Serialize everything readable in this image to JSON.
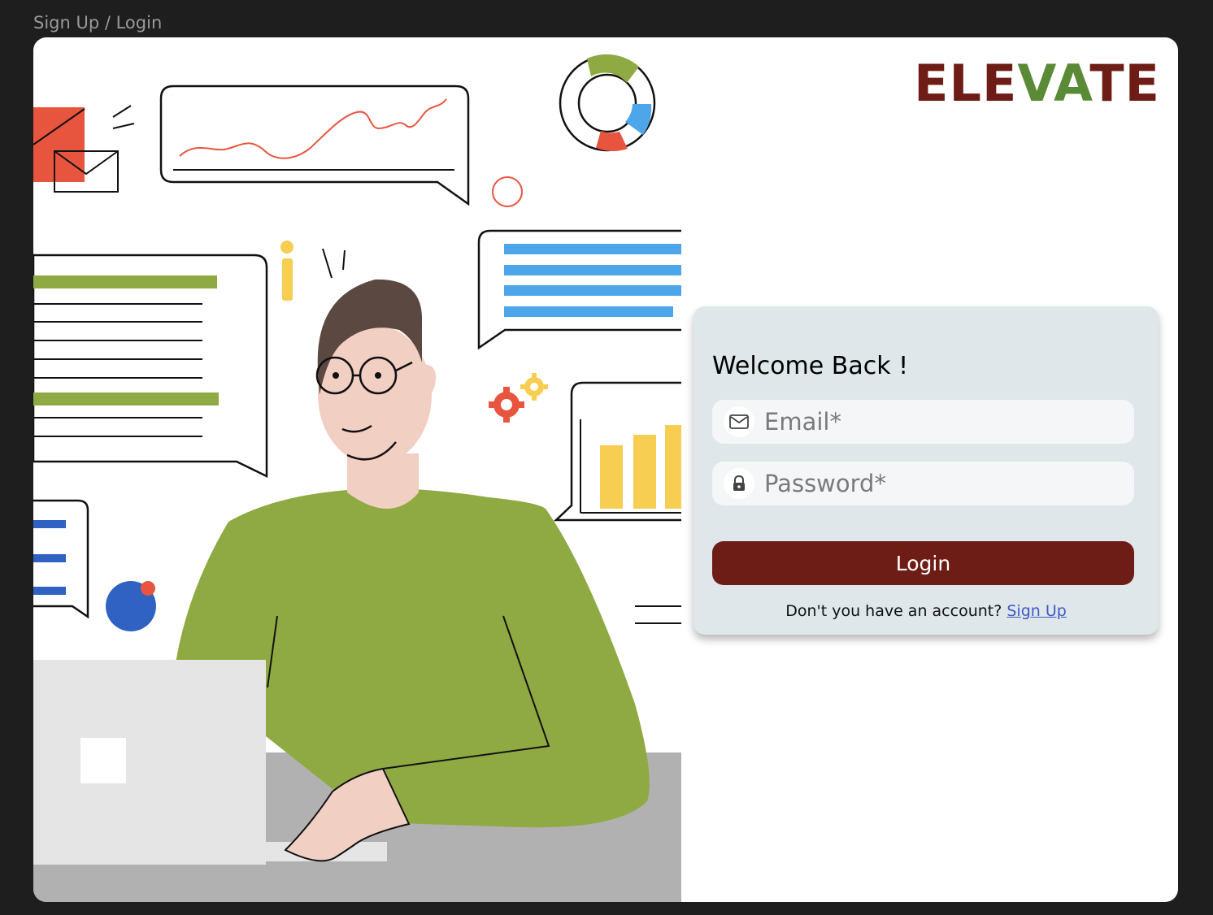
{
  "window": {
    "title": "Sign Up / Login"
  },
  "brand": {
    "parts": [
      {
        "text": "ELE",
        "color": "#6e1c16"
      },
      {
        "text": "VA",
        "color": "#5a8a35"
      },
      {
        "text": "TE",
        "color": "#6e1c16"
      }
    ]
  },
  "login": {
    "heading": "Welcome Back !",
    "email_placeholder": "Email*",
    "password_placeholder": "Password*",
    "submit_label": "Login",
    "signup_prompt": "Don't you have an account?",
    "signup_link": "Sign Up"
  },
  "colors": {
    "accent": "#6e1c16",
    "brand_green": "#5a8a35",
    "panel_bg": "#dfe7ea",
    "link": "#3f59c5"
  },
  "icons": {
    "email": "envelope-icon",
    "password": "lock-icon"
  }
}
